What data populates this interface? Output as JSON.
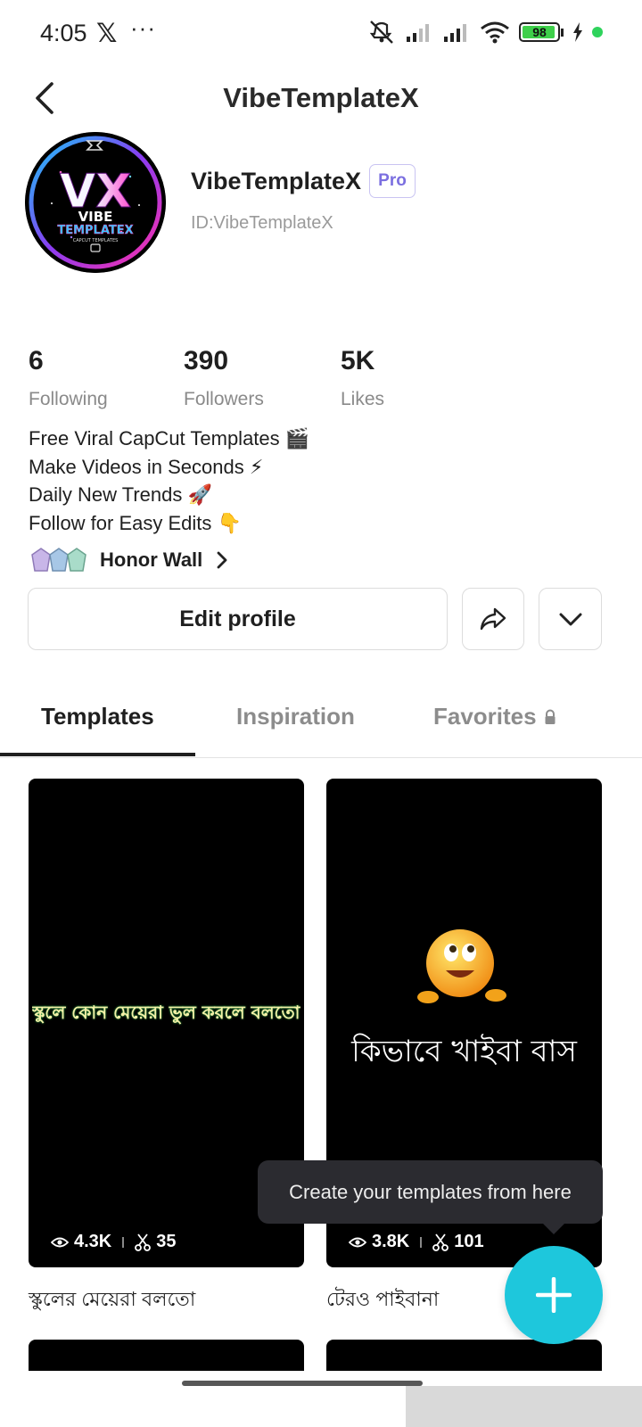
{
  "status_bar": {
    "time": "4:05",
    "x_label": "𝕏",
    "more": "···",
    "battery": "98"
  },
  "header": {
    "title": "VibeTemplateX"
  },
  "profile": {
    "name": "VibeTemplateX",
    "badge": "Pro",
    "id": "ID:VibeTemplateX",
    "logo_text_top": "VIBE",
    "logo_text_bottom": "TEMPLATEX",
    "logo_small": "CAPCUT TEMPLATES"
  },
  "stats": [
    {
      "value": "6",
      "label": "Following"
    },
    {
      "value": "390",
      "label": "Followers"
    },
    {
      "value": "5K",
      "label": "Likes"
    }
  ],
  "bio": [
    "Free Viral CapCut Templates 🎬",
    "Make Videos in Seconds ⚡",
    "Daily New Trends 🚀",
    "Follow for Easy Edits 👇"
  ],
  "honor_wall": {
    "label": "Honor Wall"
  },
  "actions": {
    "edit_profile": "Edit profile"
  },
  "tabs": [
    {
      "label": "Templates",
      "active": true
    },
    {
      "label": "Inspiration",
      "active": false
    },
    {
      "label": "Favorites",
      "active": false,
      "locked": true
    }
  ],
  "templates": [
    {
      "title": "স্কুলের মেয়েরা বলতো",
      "overlay_text": "স্কুলে কোন মেয়েরা ভুল করলে বলতো..",
      "views": "4.3K",
      "uses": "35"
    },
    {
      "title": "টেরও পাইবানা",
      "overlay_text": "কিভাবে খাইবা বাস",
      "views": "3.8K",
      "uses": "101"
    }
  ],
  "tooltip": {
    "text": "Create your templates from here"
  },
  "colors": {
    "accent": "#1ec7dc",
    "pro": "#7b6fe0",
    "tooltip_bg": "#2b2b30",
    "battery": "#3ecf4a"
  }
}
